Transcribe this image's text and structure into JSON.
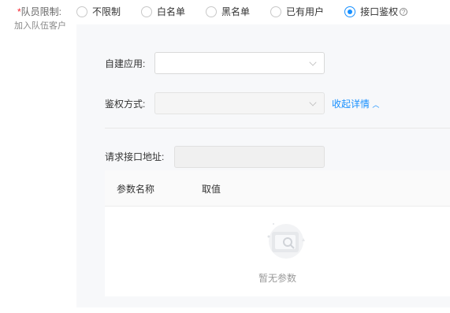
{
  "form": {
    "team_limit_label": "队员限制:",
    "required_mark": "*",
    "add_team_customer": "加入队伍客户",
    "radios": [
      {
        "label": "不限制",
        "checked": false
      },
      {
        "label": "白名单",
        "checked": false
      },
      {
        "label": "黑名单",
        "checked": false
      },
      {
        "label": "已有用户",
        "checked": false
      },
      {
        "label": "接口鉴权",
        "checked": true
      }
    ],
    "help_icon": "question-circle-icon"
  },
  "panel": {
    "self_app_label": "自建应用:",
    "self_app_value": "",
    "auth_method_label": "鉴权方式:",
    "auth_method_value": "",
    "collapse_link": "收起详情",
    "request_url_label": "请求接口地址:",
    "request_url_value": "",
    "table": {
      "columns": [
        "参数名称",
        "取值"
      ],
      "empty_text": "暂无参数"
    }
  },
  "colors": {
    "accent": "#1890ff",
    "required": "#f5222d",
    "panel_bg": "#f7f8fa"
  }
}
